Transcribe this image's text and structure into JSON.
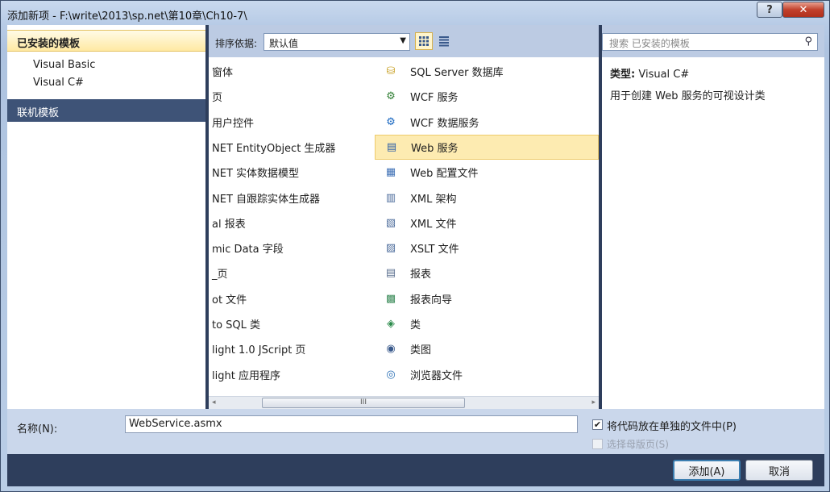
{
  "window": {
    "title": "添加新项 - F:\\write\\2013\\sp.net\\第10章\\Ch10-7\\",
    "help_label": "?",
    "close_label": "✕"
  },
  "left_panel": {
    "installed_header": "已安装的模板",
    "tree": [
      "Visual Basic",
      "Visual C#"
    ],
    "online_header": "联机模板"
  },
  "toolbar": {
    "sort_label": "排序依据:",
    "sort_value": "默认值"
  },
  "templates": {
    "col1": [
      "窗体",
      "页",
      "用户控件",
      "NET EntityObject 生成器",
      "NET 实体数据模型",
      "NET 自跟踪实体生成器",
      "al 报表",
      "mic Data 字段",
      "_页",
      "ot 文件",
      "to SQL 类",
      "light 1.0 JScript 页",
      "light 应用程序"
    ],
    "col2": [
      {
        "label": "SQL Server 数据库",
        "icon": "database-icon"
      },
      {
        "label": "WCF 服务",
        "icon": "wcf-service-icon"
      },
      {
        "label": "WCF 数据服务",
        "icon": "wcf-data-service-icon"
      },
      {
        "label": "Web 服务",
        "icon": "web-service-icon"
      },
      {
        "label": "Web 配置文件",
        "icon": "web-config-icon"
      },
      {
        "label": "XML 架构",
        "icon": "xml-schema-icon"
      },
      {
        "label": "XML 文件",
        "icon": "xml-file-icon"
      },
      {
        "label": "XSLT 文件",
        "icon": "xslt-file-icon"
      },
      {
        "label": "报表",
        "icon": "report-icon"
      },
      {
        "label": "报表向导",
        "icon": "report-wizard-icon"
      },
      {
        "label": "类",
        "icon": "class-icon"
      },
      {
        "label": "类图",
        "icon": "class-diagram-icon"
      },
      {
        "label": "浏览器文件",
        "icon": "browser-file-icon"
      }
    ],
    "selected": "Web 服务"
  },
  "search": {
    "placeholder": "搜索 已安装的模板"
  },
  "details": {
    "type_label": "类型:",
    "type_value": "Visual C#",
    "description": "用于创建 Web 服务的可视设计类"
  },
  "bottom": {
    "name_label": "名称(N):",
    "name_value": "WebService.asmx",
    "checkbox1_label": "将代码放在单独的文件中(P)",
    "checkbox1_checked": true,
    "checkbox2_label": "选择母版页(S)",
    "checkbox2_checked": false,
    "add_button": "添加(A)",
    "cancel_button": "取消"
  },
  "scrollbar": {
    "left_arrow": "◂",
    "right_arrow": "▸",
    "thumb_grip": "III"
  },
  "colors": {
    "selected_bg": "#fdebb1",
    "online_header_bg": "#3e5377",
    "dialog_bg": "#2e3e5c"
  }
}
